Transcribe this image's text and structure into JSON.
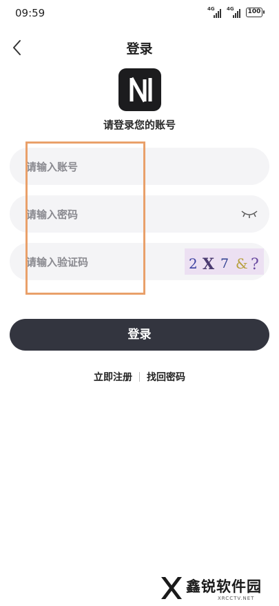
{
  "status_bar": {
    "time": "09:59",
    "sim1": "4G",
    "sim2": "4G",
    "battery": "100"
  },
  "header": {
    "title": "登录"
  },
  "app": {
    "logo_letter": "N",
    "subtitle": "请登录您的账号"
  },
  "form": {
    "account_placeholder": "请输入账号",
    "password_placeholder": "请输入密码",
    "captcha_placeholder": "请输入验证码",
    "captcha_text": "2X7&?"
  },
  "login_button": "登录",
  "links": {
    "register": "立即注册",
    "find_password": "找回密码"
  },
  "watermark": {
    "name": "鑫锐软件园",
    "site": "XRCCTV.NET"
  },
  "colors": {
    "accent_button": "#33353f",
    "highlight_border": "#e9a06a",
    "field_bg": "#f4f4f6",
    "captcha_bg": "#ece0f2"
  },
  "icons": [
    "back-arrow-icon",
    "eye-closed-icon",
    "signal-icon",
    "battery-icon"
  ]
}
